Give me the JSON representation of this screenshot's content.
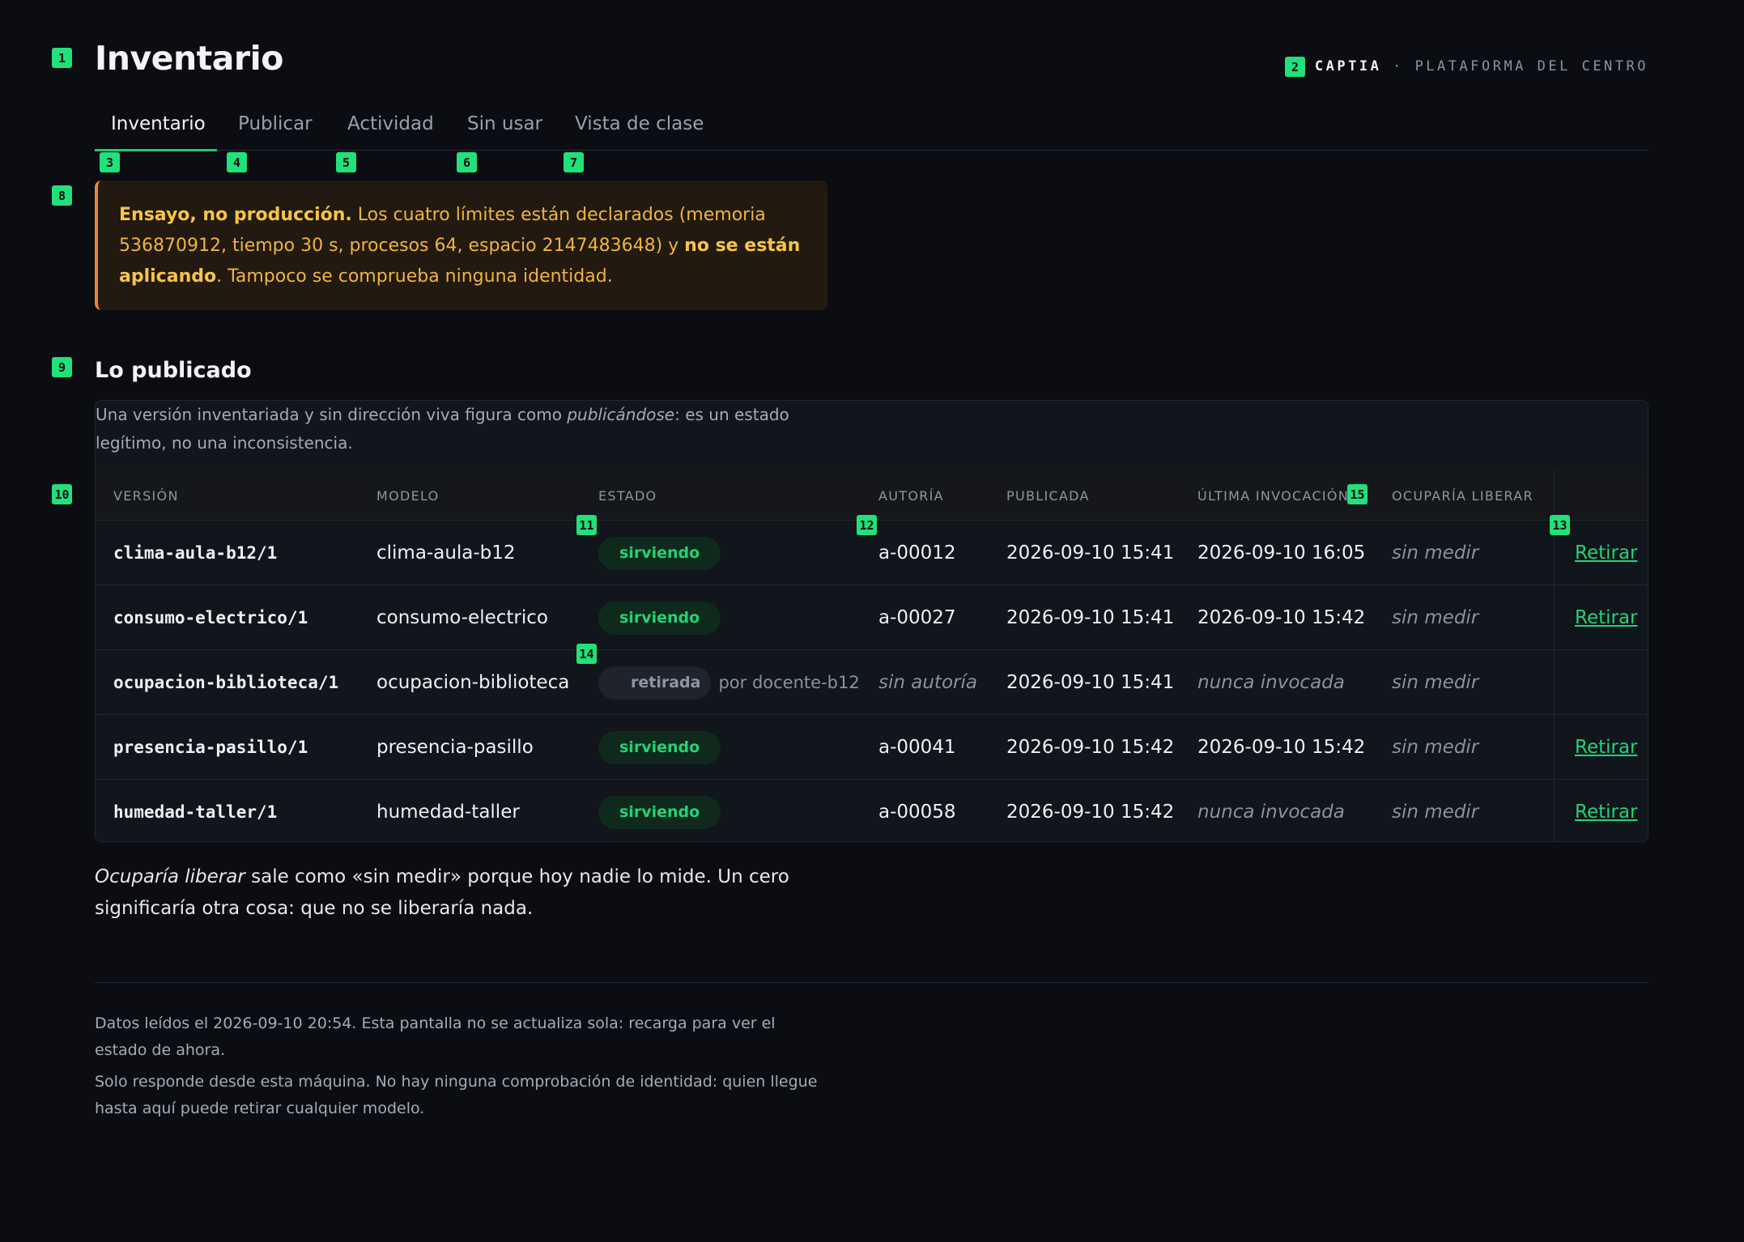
{
  "header": {
    "title": "Inventario",
    "brand_name": "CAPTIA",
    "brand_separator": " · ",
    "brand_subtitle": "PLATAFORMA DEL CENTRO"
  },
  "tabs": [
    {
      "label": "Inventario",
      "active": true
    },
    {
      "label": "Publicar",
      "active": false
    },
    {
      "label": "Actividad",
      "active": false
    },
    {
      "label": "Sin usar",
      "active": false
    },
    {
      "label": "Vista de clase",
      "active": false
    }
  ],
  "warning": {
    "bold_lead": "Ensayo, no producción.",
    "text_a": " Los cuatro límites están declarados (memoria 536870912, tiempo 30 s, procesos 64, espacio 2147483648) y ",
    "bold_mid": "no se están aplicando",
    "text_b": ". Tampoco se comprueba ninguna identidad."
  },
  "section": {
    "title": "Lo publicado",
    "intro_a": "Una versión inventariada y sin dirección viva figura como ",
    "intro_em": "publicándose",
    "intro_b": ": es un estado legítimo, no una inconsistencia."
  },
  "table": {
    "columns": [
      "Versión",
      "Modelo",
      "Estado",
      "Autoría",
      "Publicada",
      "Última invocación",
      "Ocuparía liberar"
    ],
    "rows": [
      {
        "version": "clima-aula-b12/1",
        "model": "clima-aula-b12",
        "status": "sirviendo",
        "author": "a-00012",
        "published": "2026-09-10 15:41",
        "last_call": "2026-09-10 16:05",
        "free": "sin medir",
        "action": "Retirar"
      },
      {
        "version": "consumo-electrico/1",
        "model": "consumo-electrico",
        "status": "sirviendo",
        "author": "a-00027",
        "published": "2026-09-10 15:41",
        "last_call": "2026-09-10 15:42",
        "free": "sin medir",
        "action": "Retirar"
      },
      {
        "version": "ocupacion-biblioteca/1",
        "model": "ocupacion-biblioteca",
        "status": "retirada",
        "status_by": "por docente-b12",
        "author": "sin autoría",
        "published": "2026-09-10 15:41",
        "last_call": "nunca invocada",
        "free": "sin medir",
        "action": ""
      },
      {
        "version": "presencia-pasillo/1",
        "model": "presencia-pasillo",
        "status": "sirviendo",
        "author": "a-00041",
        "published": "2026-09-10 15:42",
        "last_call": "2026-09-10 15:42",
        "free": "sin medir",
        "action": "Retirar"
      },
      {
        "version": "humedad-taller/1",
        "model": "humedad-taller",
        "status": "sirviendo",
        "author": "a-00058",
        "published": "2026-09-10 15:42",
        "last_call": "nunca invocada",
        "free": "sin medir",
        "action": "Retirar"
      }
    ]
  },
  "note": {
    "em": "Ocuparía liberar",
    "text": " sale como «sin medir» porque hoy nadie lo mide. Un cero significaría otra cosa: que no se liberaría nada."
  },
  "footer": {
    "line1": "Datos leídos el 2026-09-10 20:54. Esta pantalla no se actualiza sola: recarga para ver el estado de ahora.",
    "line2": "Solo responde desde esta máquina. No hay ninguna comprobación de identidad: quien llegue hasta aquí puede retirar cualquier modelo."
  },
  "markers": [
    "1",
    "2",
    "3",
    "4",
    "5",
    "6",
    "7",
    "8",
    "9",
    "10",
    "11",
    "12",
    "13",
    "14",
    "15"
  ],
  "colors": {
    "background": "#0b0d12",
    "accent": "#22d375",
    "warning": "#f0b43c",
    "warning_border": "#e8862a"
  }
}
